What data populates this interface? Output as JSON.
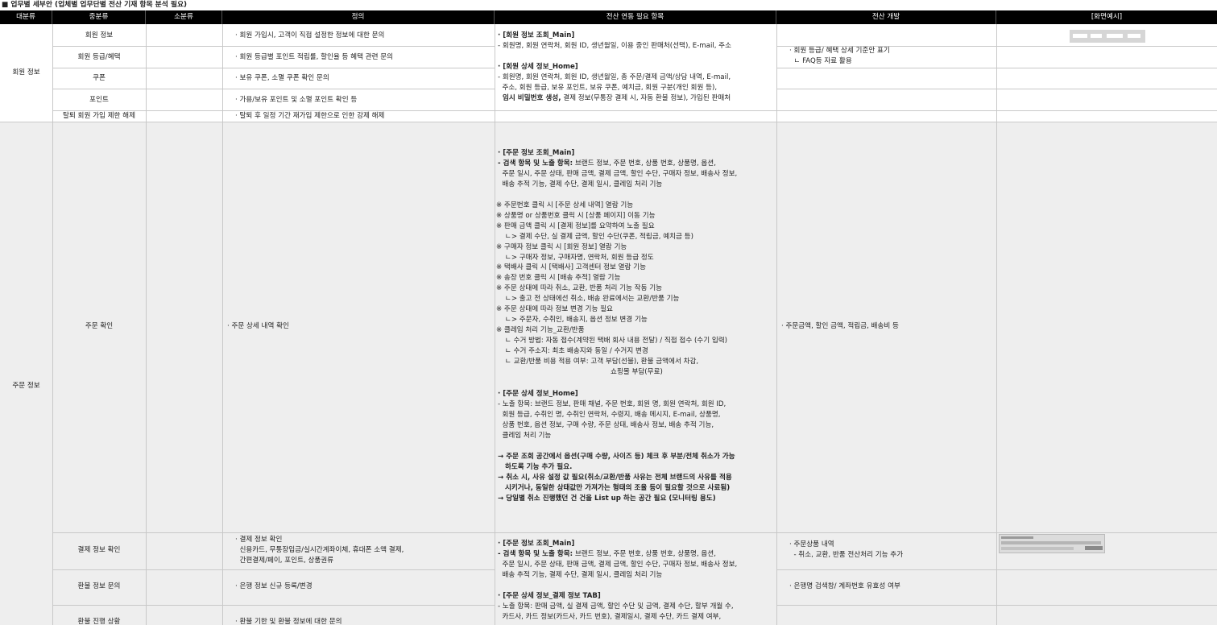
{
  "title": "■ 업무별 세부안 (업체별 업무단별 전산 기재 항목 분석 필요)",
  "headers": [
    "대분류",
    "중분류",
    "소분류",
    "정의",
    "전산 연동 필요 항목",
    "전산 개발",
    "[화면예시]"
  ],
  "member": {
    "category": "회원 정보",
    "rows": [
      {
        "mid": "회원 정보",
        "def": "· 회원 가입시, 고객이 직접 설정한 정보에 대한 문의"
      },
      {
        "mid": "회원 등급/혜택",
        "def": "· 회원 등급별 포인트 적립률, 할인율 등 혜택 관련 문의"
      },
      {
        "mid": "쿠폰",
        "def": "· 보유 쿠폰, 소멸 쿠폰 확인 문의"
      },
      {
        "mid": "포인트",
        "def": "· 가용/보유 포인트 및 소멸 포인트 확인 등"
      },
      {
        "mid": "탈퇴 회원 가입 제한 해제",
        "def": "· 탈퇴 후 일정 기간 재가입 제한으로 인한 강제 해제"
      }
    ],
    "link_main_title": "· [회원 정보 조회_Main]",
    "link_main_body": "- 회원명, 회원 연락처, 회원 ID, 생년월일, 이용 중인 판매처(선택), E-mail, 주소",
    "link_home_title": "· [회원 상세 정보_Home]",
    "link_home_body": "- 회원명, 회원 연락처, 회원 ID, 생년월일, 총 주문/결제 금액/상담 내역, E-mail,\n  주소, 회원 등급, 보유 포인트, 보유 쿠폰, 예치금, 회원 구분(개인 회원 등),",
    "link_home_bold": "  임시 비밀번호 생성,",
    "link_home_tail": " 결제 정보(무통장 결제 시, 자동 환불 정보), 가입된 판매처",
    "dev": "· 회원 등급/ 혜택 상세 기준안 표기\n  ㄴ FAQ등 자료 활용"
  },
  "order": {
    "category": "주문 정보",
    "confirm_mid": "주문 확인",
    "confirm_def": "· 주문 상세 내역 확인",
    "confirm_dev": "· 주문금액, 할인 금액, 적립금, 배송비 등",
    "block1_title": "· [주문 정보 조회_Main]",
    "block1_bold": "- 검색 항목 및 노출 항목:",
    "block1_first": " 브랜드 정보, 주문 번호, 상품 번호, 상품명, 옵션,",
    "block1_body": "  주문 일시, 주문 상태, 판매 금액, 결제 금액, 할인 수단, 구매자 정보, 배송사 정보,\n  배송 추적 기능, 결제 수단, 결제 일시, 클레임 처리 기능",
    "block1_notes": "※ 주문번호 클릭 시 [주문 상세 내역] 열람 기능\n※ 상품명 or 상품번호 클릭 시 [상품 페이지] 이동 기능\n※ 판매 금액 클릭 시 [결제 정보]를 요약하여 노출 필요\n    ㄴ> 결제 수단, 실 결제 금액, 할인 수단(쿠폰, 적립금, 예치금 등)\n※ 구매자 정보 클릭 시 [회원 정보] 열람 기능\n    ㄴ> 구매자 정보, 구매자명, 연락처, 회원 등급 정도\n※ 택배사 클릭 시 [택배사] 고객센터 정보 열람 기능\n※ 송장 번호 클릭 시 [배송 추적] 열람 기능\n※ 주문 상태에 따라 취소, 교환, 반품 처리 기능 작동 기능\n    ㄴ> 출고 전 상태에선 취소, 배송 완료에서는 교환/반품 기능\n※ 주문 상태에 따라 정보 변경 기능 필요\n    ㄴ> 주문자, 수취인, 배송지, 옵션 정보 변경 기능\n※ 클레임 처리 기능_교환/반품\n    ㄴ 수거 방법: 자동 접수(계약된 택배 회사 내용 전달) / 직접 접수 (수기 입력)\n    ㄴ 수거 주소지: 최초 배송지와 동일 / 수거지 변경\n    ㄴ 교환/반품 비용 적용 여부: 고객 부담(선불), 환불 금액에서 차감,\n                                                    쇼핑몰 부담(무료)",
    "block2_title": "· [주문 상세 정보_Home]",
    "block2_body": "- 노출 항목: 브랜드 정보, 판매 채널, 주문 번호, 회원 명, 회원 연락처, 회원 ID,\n  회원 등급, 수취인 명, 수취인 연락처, 수령지, 배송 메시지, E-mail, 상품명,\n  상품 번호, 옵션 정보, 구매 수량, 주문 상태, 배송사 정보, 배송 추적 기능,\n  클레임 처리 기능",
    "block2_arrows": "→ 주문 조회 공간에서 옵션(구매 수량, 사이즈 등) 체크 후 부분/전체 취소가 가능\n   하도록 기능 추가 필요.\n→ 취소 시, 사유 설정 값 필요(취소/교환/반품 사유는 전체 브랜드의 사유를 적용\n   시키거나, 동일한 상태값만 가져가는 형태의 조율 등이 필요할 것으로 사료됨)\n→ 당일별 취소 진행했던 건 건을 List up 하는 공간 필요 (모니터링 용도)",
    "pay_mid": "결제 정보 확인",
    "pay_def": "· 결제 정보 확인\n  신용카드, 무통장입금/실시간계좌이체, 휴대폰 소액 결제,\n  간편결제/페이, 포인트, 상품권류",
    "pay_dev": "· 주문상품 내역\n  - 취소, 교환, 반품 전산처리 기능 추가",
    "refund_mid": "환불 정보 문의",
    "refund_def": "· 은행 정보 신규 등록/변경",
    "refund_dev": "· 은행명 검색창/ 계좌번호 유효성 여부",
    "progress_mid": "환불 진행 상황",
    "progress_def": "· 환불 기한 및 환불 정보에 대한 문의",
    "block3_title": "· [주문 정보 조회_Main]",
    "block3_bold": "- 검색 항목 및 노출 항목:",
    "block3_first": " 브랜드 정보, 주문 번호, 상품 번호, 상품명, 옵션,",
    "block3_body": "  주문 일시, 주문 상태, 판매 금액, 결제 금액, 할인 수단, 구매자 정보, 배송사 정보,\n  배송 추적 기능, 결제 수단, 결제 일시, 클레임 처리 기능",
    "block4_title": "· [주문 상세 정보_결제 정보 TAB]",
    "block4_body": "- 노출 항목: 판매 금액, 실 결제 금액, 할인 수단 및 금액, 결제 수단, 할부 개월 수,\n  카드사, 카드 정보(카드사, 카드 번호), 결제일시, 결제 수단, 카드 결제 여부,"
  },
  "colors": {
    "header_bg": "#000000",
    "gray_bg": "#eeeeee",
    "grid": "#c8c8c8"
  }
}
